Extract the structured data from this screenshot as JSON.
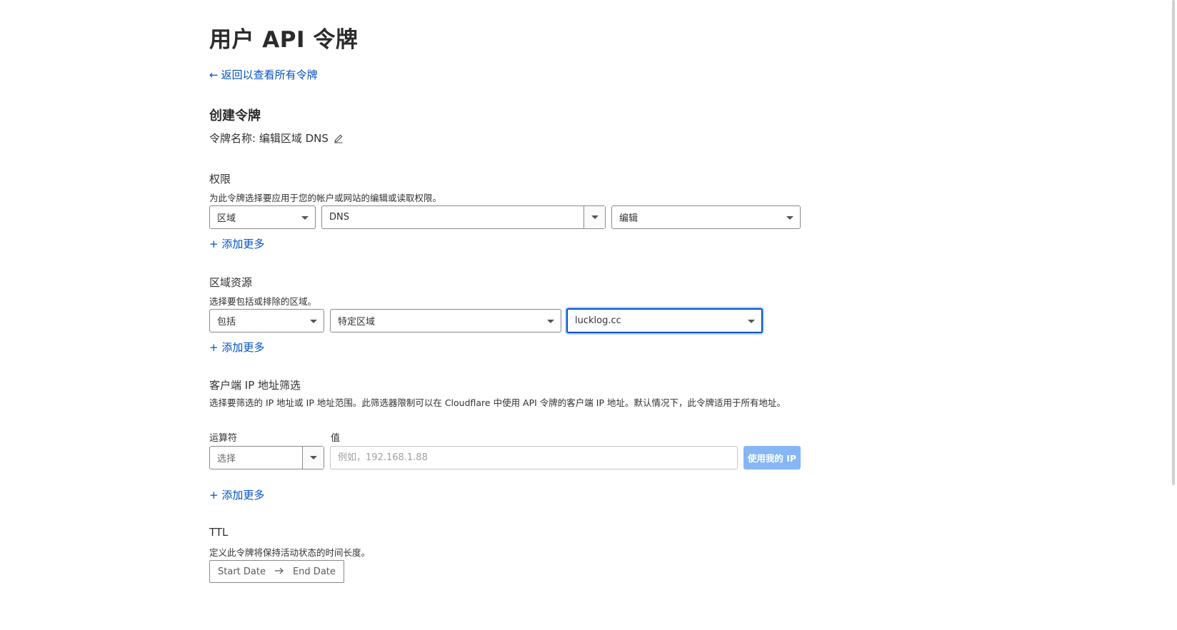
{
  "page": {
    "title": "用户 API 令牌",
    "back_link": "返回以查看所有令牌"
  },
  "create": {
    "title": "创建令牌",
    "token_name_label": "令牌名称: 编辑区域 DNS"
  },
  "permissions": {
    "title": "权限",
    "description": "为此令牌选择要应用于您的帐户或网站的编辑或读取权限。",
    "scope_value": "区域",
    "resource_value": "DNS",
    "access_value": "编辑",
    "add_more": "+ 添加更多"
  },
  "zone_resources": {
    "title": "区域资源",
    "description": "选择要包括或排除的区域。",
    "include_value": "包括",
    "zone_type_value": "特定区域",
    "zone_value": "lucklog.cc",
    "add_more": "+ 添加更多"
  },
  "ip_filter": {
    "title": "客户端 IP 地址筛选",
    "description": "选择要筛选的 IP 地址或 IP 地址范围。此筛选器限制可以在 Cloudflare 中使用 API 令牌的客户端 IP 地址。默认情况下，此令牌适用于所有地址。",
    "operator_label": "运算符",
    "value_label": "值",
    "operator_value": "选择",
    "value_placeholder": "例如，192.168.1.88",
    "use_my_ip_button": "使用我的 IP",
    "add_more": "+ 添加更多"
  },
  "ttl": {
    "title": "TTL",
    "description": "定义此令牌将保持活动状态的时间长度。",
    "start_date": "Start Date",
    "end_date": "End Date"
  },
  "colors": {
    "link": "#0051c3",
    "button_disabled": "#86b6f3",
    "focus_border": "#0051c3"
  }
}
